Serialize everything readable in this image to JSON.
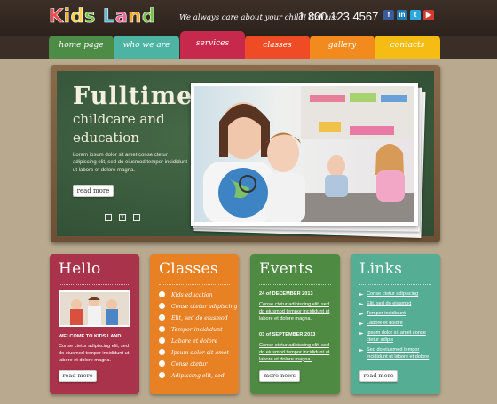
{
  "header": {
    "logo_text": "Kids Land",
    "logo_letters": [
      "K",
      "i",
      "d",
      "s",
      " ",
      "L",
      "a",
      "n",
      "d"
    ],
    "logo_colors": [
      "#e84c4c",
      "#f5a623",
      "#f7d14c",
      "#78c04a",
      "#ffffff",
      "#4fb8d8",
      "#e86a9a",
      "#f5a623",
      "#78c04a"
    ],
    "tagline": "We always care about your child! Call us:",
    "phone": "1 800 123 4567",
    "social": [
      {
        "icon": "facebook-icon",
        "glyph": "f",
        "color": "#3b5b98"
      },
      {
        "icon": "linkedin-icon",
        "glyph": "in",
        "color": "#1e7bb8"
      },
      {
        "icon": "twitter-icon",
        "glyph": "t",
        "color": "#2aa9e0"
      },
      {
        "icon": "youtube-icon",
        "glyph": "▶",
        "color": "#d23a2f"
      }
    ]
  },
  "nav": [
    {
      "label": "home page",
      "color": "#4c8c46",
      "active": false
    },
    {
      "label": "who we are",
      "color": "#4db3a3",
      "active": false
    },
    {
      "label": "services",
      "color": "#c7294c",
      "active": true
    },
    {
      "label": "classes",
      "color": "#ef4b24",
      "active": false
    },
    {
      "label": "gallery",
      "color": "#f28a1e",
      "active": false
    },
    {
      "label": "contacts",
      "color": "#f5bd14",
      "active": false
    }
  ],
  "hero": {
    "title": "Fulltime",
    "subtitle": "childcare and education",
    "text": "Lorem ipsum dolor sit amet conse ctetur adipiscing elit, sed do eiusmod tempor incididunt ut labore et dolore magna.",
    "button": "read more",
    "dots": [
      "",
      "x",
      ""
    ]
  },
  "boxes": {
    "hello": {
      "title": "Hello",
      "color": "#a8334a",
      "heading": "WELCOME TO KIDS LAND",
      "text": "Conse ctetur adipiscing elit, sed do eiusmod tempor incididunt ut labore et dolore magna.",
      "button": "read more"
    },
    "classes": {
      "title": "Classes",
      "color": "#e88024",
      "items": [
        "Kids education",
        "Conse ctetur adipiscing",
        "Elit, sed do eiusmod",
        "Tempor incididunt",
        "Labore et dolore",
        "Ipsum dolor sit amet",
        "Conse ctetur",
        "Adipiscing elit, sed"
      ]
    },
    "events": {
      "title": "Events",
      "color": "#4f8a42",
      "events": [
        {
          "date": "24 of DECEMBER 2013",
          "text": "Conse ctetur adipiscing elit, sed do eiusmod tempor incididunt ut labore et dolore magna."
        },
        {
          "date": "03 of SEPTEMBER 2013",
          "text": "Conse ctetur adipiscing elit, sed do eiusmod tempor incididunt ut labore et dolore magna."
        }
      ],
      "button": "more news"
    },
    "links": {
      "title": "Links",
      "color": "#55ae93",
      "items": [
        "Conse ctetur adipiscing",
        "Elit, sed do eiusmod",
        "Tempor incididunt",
        "Labore et dolore",
        "Ipsum dolor sit amet conse ctetur adipis",
        "Sed do eiusmod tempor incididunt ut labore et dolore"
      ],
      "button": "read more"
    }
  }
}
